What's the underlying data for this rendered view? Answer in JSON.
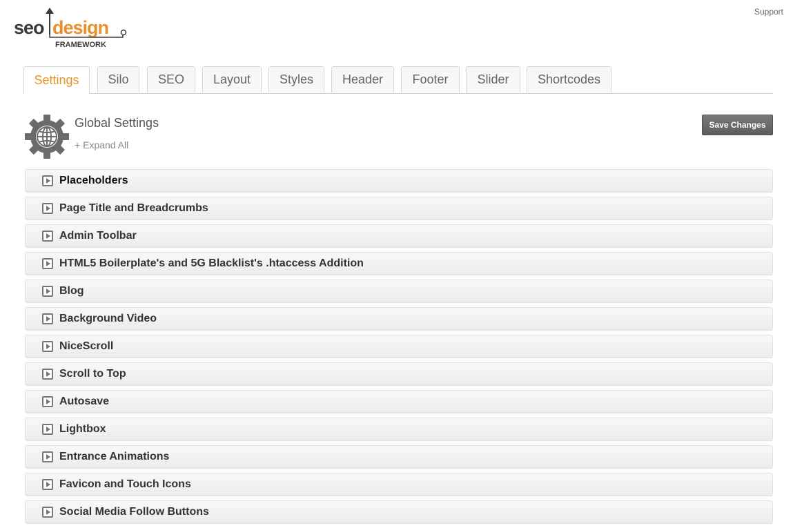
{
  "header": {
    "support_label": "Support",
    "logo": {
      "word1": "seo",
      "word2": "design",
      "sub": "FRAMEWORK"
    }
  },
  "tabs": [
    {
      "label": "Settings",
      "active": true
    },
    {
      "label": "Silo"
    },
    {
      "label": "SEO"
    },
    {
      "label": "Layout"
    },
    {
      "label": "Styles"
    },
    {
      "label": "Header"
    },
    {
      "label": "Footer"
    },
    {
      "label": "Slider"
    },
    {
      "label": "Shortcodes"
    }
  ],
  "panel": {
    "title": "Global Settings",
    "expand_all": "+ Expand All",
    "save_label": "Save Changes"
  },
  "sections": [
    "Placeholders",
    "Page Title and Breadcrumbs",
    "Admin Toolbar",
    "HTML5 Boilerplate's and 5G Blacklist's .htaccess Addition",
    "Blog",
    "Background Video",
    "NiceScroll",
    "Scroll to Top",
    "Autosave",
    "Lightbox",
    "Entrance Animations",
    "Favicon and Touch Icons",
    "Social Media Follow Buttons"
  ],
  "colors": {
    "accent": "#e8912b",
    "logo_dark": "#3a3a3a",
    "button": "#666666"
  }
}
